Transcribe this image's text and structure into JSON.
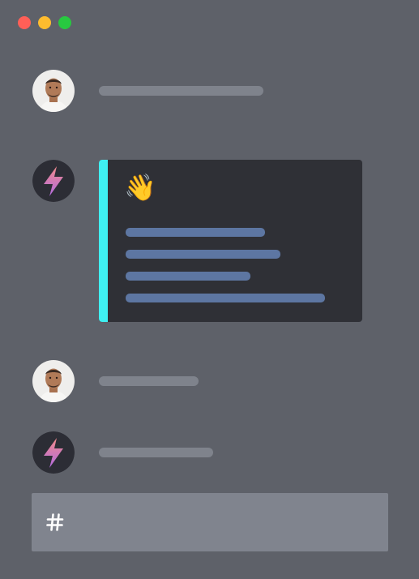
{
  "window": {
    "controls": [
      "close",
      "minimize",
      "maximize"
    ],
    "colors": {
      "close": "#ff5f57",
      "minimize": "#febc2e",
      "maximize": "#28c840"
    }
  },
  "messages": [
    {
      "author": "user",
      "avatar": "person-avatar",
      "content": "placeholder-line"
    },
    {
      "author": "bot",
      "avatar": "bolt-avatar",
      "content": "embed-card",
      "embed": {
        "emoji": "👋",
        "accent": "#3ff0f2",
        "lines": 4
      }
    },
    {
      "author": "user",
      "avatar": "person-avatar",
      "content": "placeholder-line"
    },
    {
      "author": "bot",
      "avatar": "bolt-avatar",
      "content": "placeholder-line"
    }
  ],
  "composer": {
    "icon": "hash-icon"
  },
  "colors": {
    "background": "#5e6169",
    "embed_bg": "#2f3036",
    "embed_line": "#5d76a2",
    "skeleton": "#7f838c",
    "composer": "#80848e"
  }
}
